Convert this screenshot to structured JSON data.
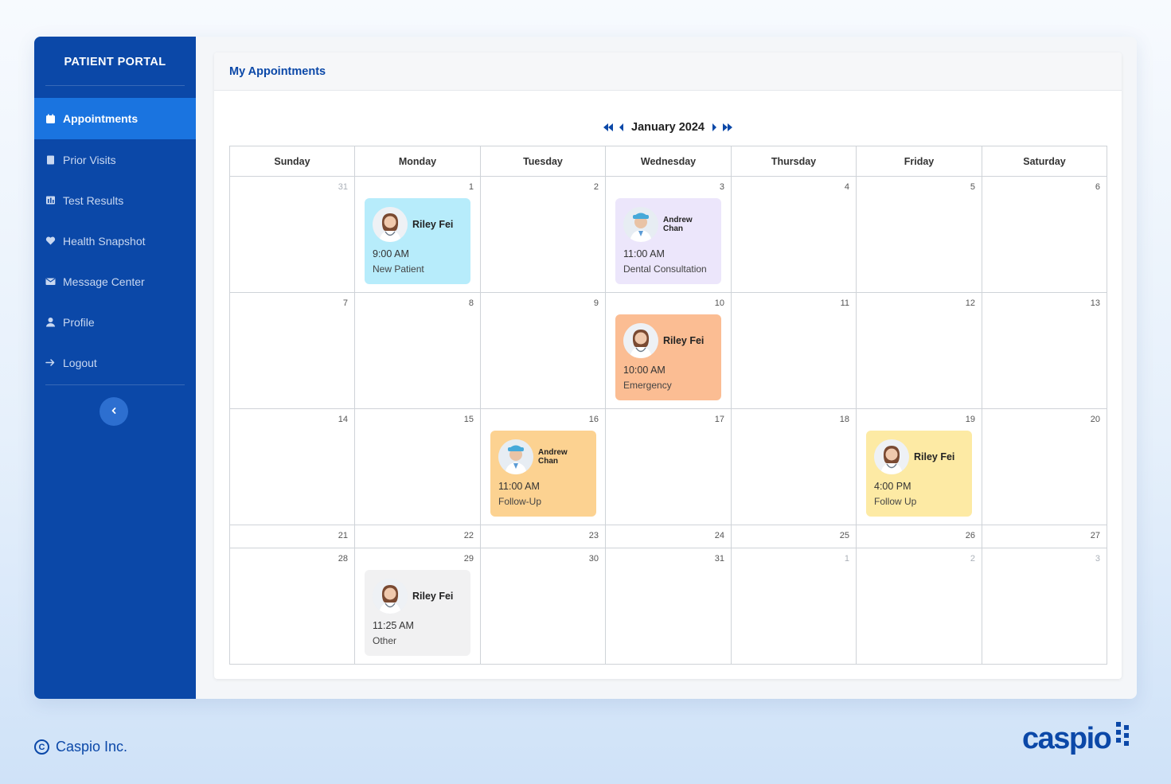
{
  "sidebar": {
    "title": "PATIENT PORTAL",
    "items": [
      {
        "label": "Appointments",
        "icon": "calendar-icon",
        "active": true
      },
      {
        "label": "Prior Visits",
        "icon": "clipboard-icon",
        "active": false
      },
      {
        "label": "Test Results",
        "icon": "chart-icon",
        "active": false
      },
      {
        "label": "Health Snapshot",
        "icon": "heart-icon",
        "active": false
      },
      {
        "label": "Message Center",
        "icon": "envelope-icon",
        "active": false
      },
      {
        "label": "Profile",
        "icon": "user-icon",
        "active": false
      },
      {
        "label": "Logout",
        "icon": "arrow-right-icon",
        "active": false
      }
    ],
    "collapse_icon": "chevron-left-icon"
  },
  "panel": {
    "title": "My Appointments"
  },
  "calendar": {
    "month_label": "January 2024",
    "weekdays": [
      "Sunday",
      "Monday",
      "Tuesday",
      "Wednesday",
      "Thursday",
      "Friday",
      "Saturday"
    ],
    "weeks": [
      {
        "height": "normal",
        "days": [
          {
            "n": "31",
            "muted": true
          },
          {
            "n": "1"
          },
          {
            "n": "2"
          },
          {
            "n": "3"
          },
          {
            "n": "4"
          },
          {
            "n": "5"
          },
          {
            "n": "6"
          }
        ]
      },
      {
        "height": "normal",
        "days": [
          {
            "n": "7"
          },
          {
            "n": "8"
          },
          {
            "n": "9"
          },
          {
            "n": "10"
          },
          {
            "n": "11"
          },
          {
            "n": "12"
          },
          {
            "n": "13"
          }
        ]
      },
      {
        "height": "normal",
        "days": [
          {
            "n": "14"
          },
          {
            "n": "15"
          },
          {
            "n": "16"
          },
          {
            "n": "17"
          },
          {
            "n": "18"
          },
          {
            "n": "19"
          },
          {
            "n": "20"
          }
        ]
      },
      {
        "height": "short",
        "days": [
          {
            "n": "21"
          },
          {
            "n": "22"
          },
          {
            "n": "23"
          },
          {
            "n": "24"
          },
          {
            "n": "25"
          },
          {
            "n": "26"
          },
          {
            "n": "27"
          }
        ]
      },
      {
        "height": "normal",
        "days": [
          {
            "n": "28"
          },
          {
            "n": "29"
          },
          {
            "n": "30"
          },
          {
            "n": "31"
          },
          {
            "n": "1",
            "muted": true
          },
          {
            "n": "2",
            "muted": true
          },
          {
            "n": "3",
            "muted": true
          }
        ]
      }
    ],
    "appointments": [
      {
        "week": 0,
        "day": 1,
        "name": "Riley Fei",
        "time": "9:00 AM",
        "type": "New Patient",
        "color": "#b7ecfb",
        "doctor": "female"
      },
      {
        "week": 0,
        "day": 3,
        "name": "Andrew Chan",
        "time": "11:00 AM",
        "type": "Dental Consultation",
        "color": "#ece6fb",
        "doctor": "male"
      },
      {
        "week": 1,
        "day": 3,
        "name": "Riley Fei",
        "time": "10:00 AM",
        "type": "Emergency",
        "color": "#fbbd93",
        "doctor": "female"
      },
      {
        "week": 2,
        "day": 2,
        "name": "Andrew Chan",
        "time": "11:00 AM",
        "type": "Follow-Up",
        "color": "#fcd291",
        "doctor": "male"
      },
      {
        "week": 2,
        "day": 5,
        "name": "Riley Fei",
        "time": "4:00 PM",
        "type": "Follow Up",
        "color": "#fdeaa4",
        "doctor": "female"
      },
      {
        "week": 4,
        "day": 1,
        "name": "Riley Fei",
        "time": "11:25 AM",
        "type": "Other",
        "color": "#f1f1f2",
        "doctor": "female"
      }
    ]
  },
  "footer": {
    "copyright": "Caspio Inc.",
    "logo_text": "caspio"
  },
  "colors": {
    "sidebar_bg": "#0b48a8",
    "active_bg": "#1a74e0",
    "accent_text": "#0b48a8"
  }
}
